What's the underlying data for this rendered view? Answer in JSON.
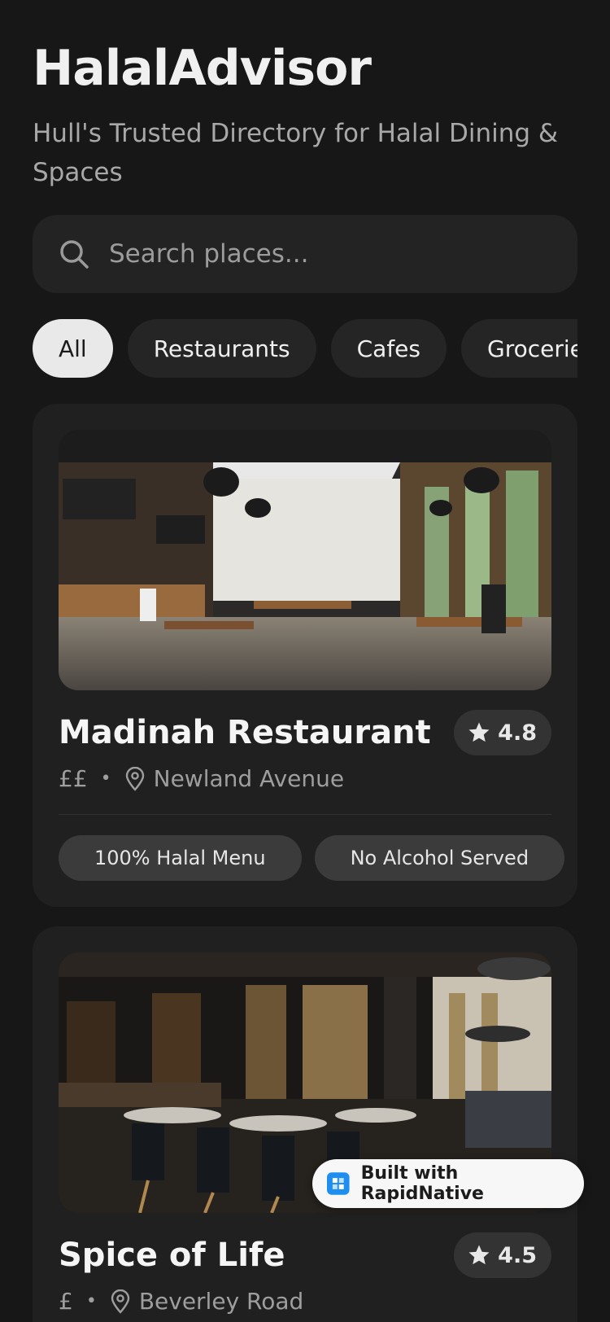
{
  "app": {
    "title": "HalalAdvisor",
    "subtitle": "Hull's Trusted Directory for Halal Dining & Spaces"
  },
  "search": {
    "placeholder": "Search places...",
    "icon": "search-icon"
  },
  "filters": [
    {
      "label": "All",
      "active": true
    },
    {
      "label": "Restaurants",
      "active": false
    },
    {
      "label": "Cafes",
      "active": false
    },
    {
      "label": "Groceries",
      "active": false
    }
  ],
  "places": [
    {
      "name": "Madinah Restaurant",
      "rating": "4.8",
      "price": "££",
      "location": "Newland Avenue",
      "image": "restaurant-interior-photo",
      "tags": [
        "100% Halal Menu",
        "No Alcohol Served"
      ]
    },
    {
      "name": "Spice of Life",
      "rating": "4.5",
      "price": "£",
      "location": "Beverley Road",
      "image": "dark-dining-room-photo"
    }
  ],
  "badge": {
    "label": "Built with RapidNative",
    "icon": "rapidnative-logo-icon",
    "color": "#1f8ef1"
  },
  "colors": {
    "background": "#171717",
    "card": "#202020",
    "chip_active": "#e9e9e9"
  }
}
